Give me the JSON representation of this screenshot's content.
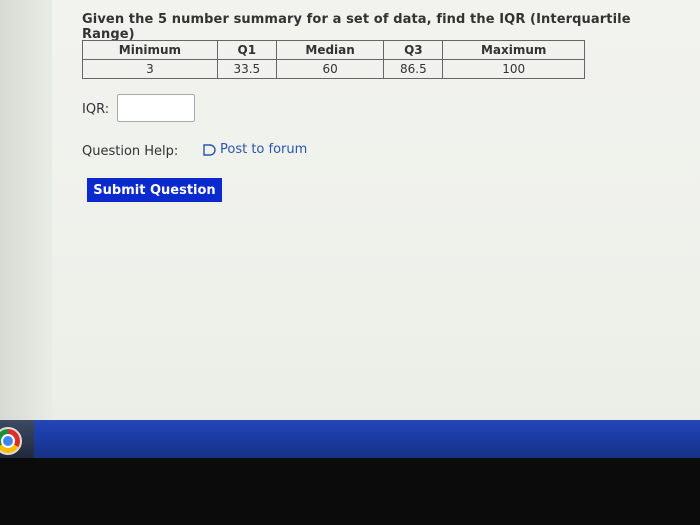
{
  "question": {
    "text": "Given the 5 number summary for a set of data, find the IQR (Interquartile Range)"
  },
  "summary_table": {
    "headers": [
      "Minimum",
      "Q1",
      "Median",
      "Q3",
      "Maximum"
    ],
    "values": [
      "3",
      "33.5",
      "60",
      "86.5",
      "100"
    ]
  },
  "answer": {
    "label": "IQR:",
    "value": "",
    "placeholder": ""
  },
  "help": {
    "label": "Question Help:",
    "link_text": "Post to forum",
    "icon": "forum-icon"
  },
  "submit": {
    "label": "Submit Question",
    "color": "#0a2ad0"
  },
  "taskbar": {
    "color": "#2447b8",
    "icons": [
      "chrome-icon"
    ]
  }
}
